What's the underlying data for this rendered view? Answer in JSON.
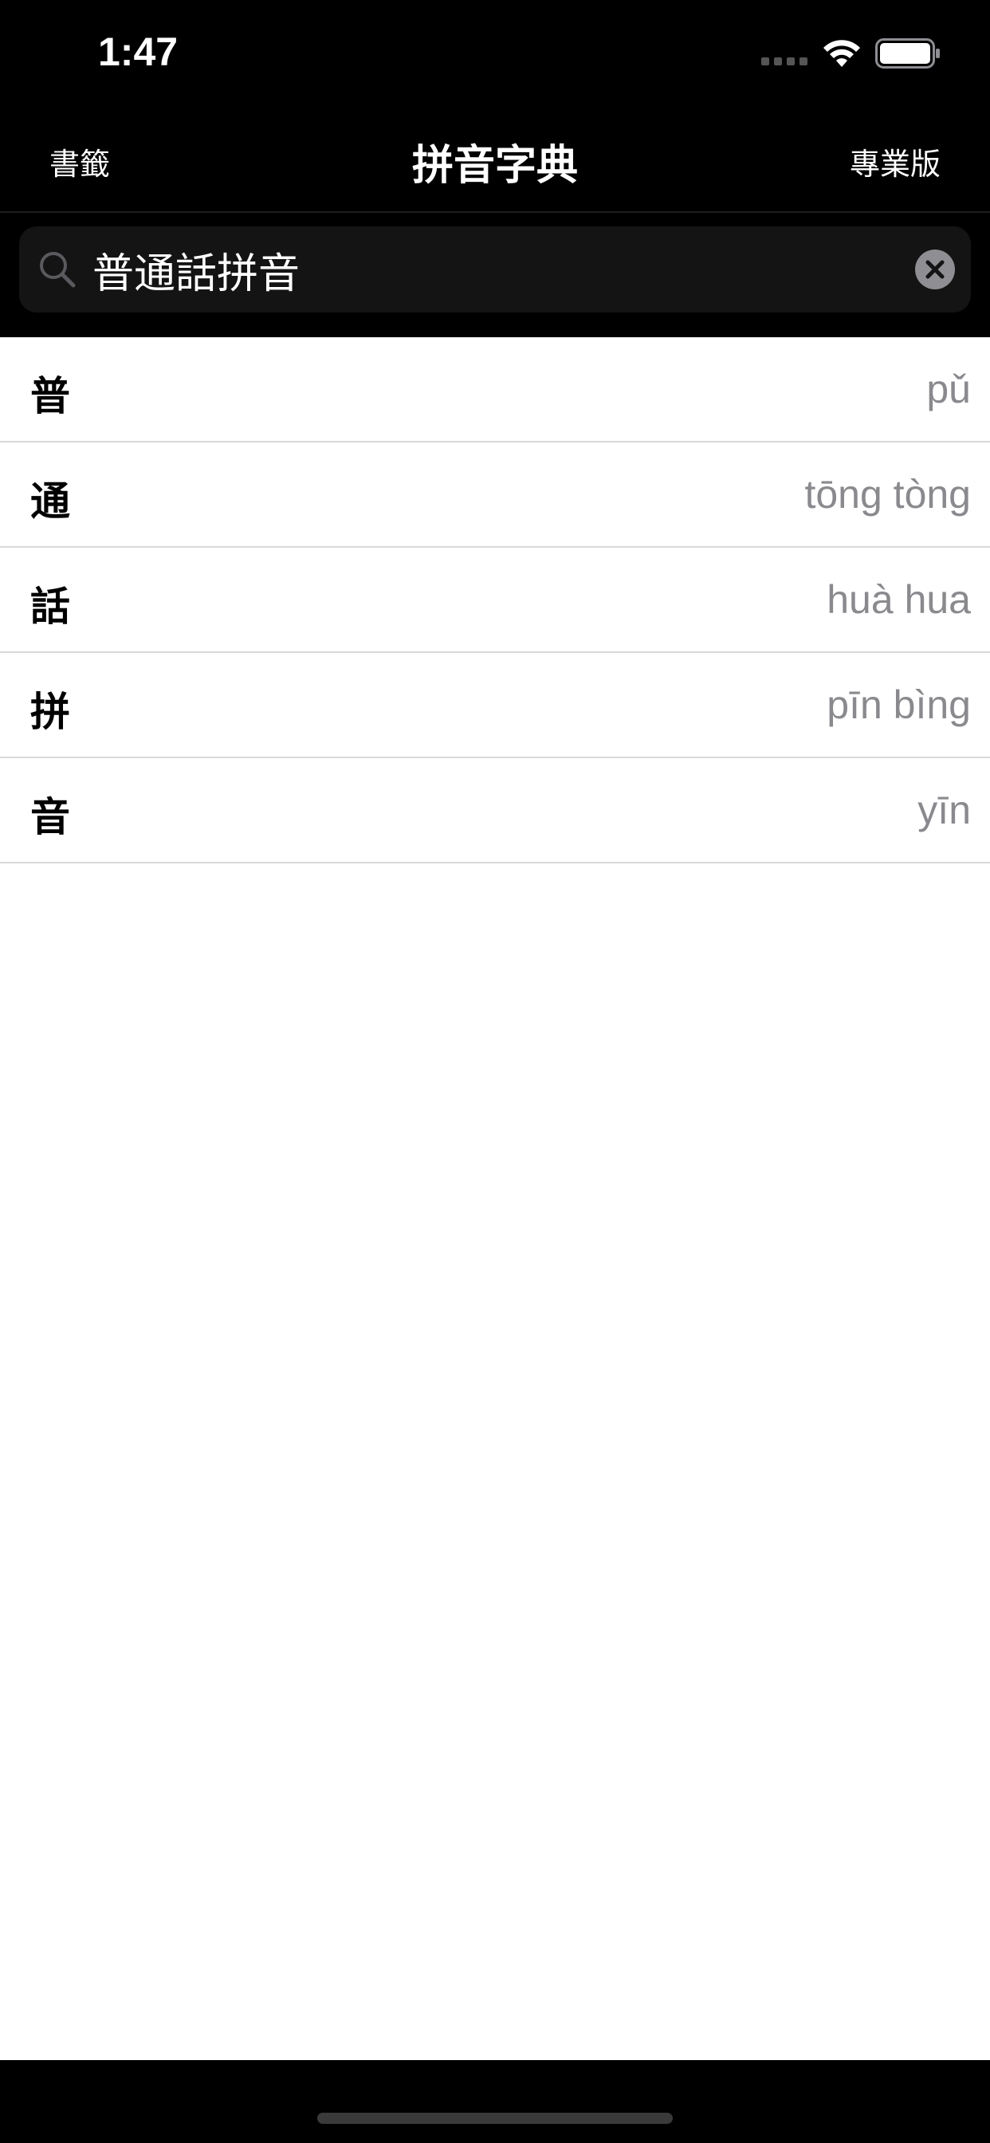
{
  "status_bar": {
    "time": "1:47"
  },
  "nav": {
    "left_label": "書籤",
    "title": "拼音字典",
    "right_label": "專業版"
  },
  "search": {
    "value": "普通話拼音"
  },
  "results": [
    {
      "char": "普",
      "pinyin": "pǔ"
    },
    {
      "char": "通",
      "pinyin": "tōng tòng"
    },
    {
      "char": "話",
      "pinyin": "huà hua"
    },
    {
      "char": "拼",
      "pinyin": "pīn bìng"
    },
    {
      "char": "音",
      "pinyin": "yīn"
    }
  ],
  "icons": {
    "signal": "signal-icon",
    "wifi": "wifi-icon",
    "battery": "battery-icon",
    "search": "search-icon",
    "clear": "clear-icon"
  },
  "colors": {
    "background": "#000000",
    "list_background": "#ffffff",
    "pinyin_text": "#8a8a8e",
    "separator": "#d9d9dc",
    "search_field": "#141414"
  }
}
